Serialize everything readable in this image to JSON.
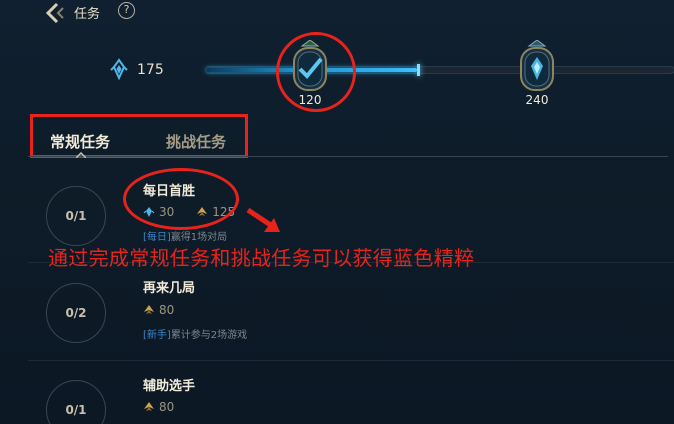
{
  "header": {
    "title": "任务",
    "help_label": "?"
  },
  "essence": {
    "count": "175"
  },
  "track": {
    "progress_fraction": 0.45,
    "milestones": [
      {
        "value": "120",
        "state": "completed"
      },
      {
        "value": "240",
        "state": "locked"
      }
    ]
  },
  "tabs": [
    {
      "label": "常规任务",
      "active": true
    },
    {
      "label": "挑战任务",
      "active": false
    }
  ],
  "quests": [
    {
      "progress": "0/1",
      "title": "每日首胜",
      "rewards": [
        {
          "icon": "blue-essence-icon",
          "value": "30"
        },
        {
          "icon": "xp-icon",
          "value": "125"
        }
      ],
      "tag": "[每日]",
      "desc": "赢得1场对局"
    },
    {
      "progress": "0/2",
      "title": "再来几局",
      "rewards": [
        {
          "icon": "xp-icon",
          "value": "80"
        }
      ],
      "tag": "[新手]",
      "desc": "累计参与2场游戏"
    },
    {
      "progress": "0/1",
      "title": "辅助选手",
      "rewards": [
        {
          "icon": "xp-icon",
          "value": "80"
        }
      ]
    }
  ],
  "annotation": {
    "text": "通过完成常规任务和挑战任务可以获得蓝色精粹"
  },
  "colors": {
    "annotation_red": "#e8231c",
    "blue_accent": "#1a8ec9",
    "gold_text": "#c8c0a8"
  }
}
